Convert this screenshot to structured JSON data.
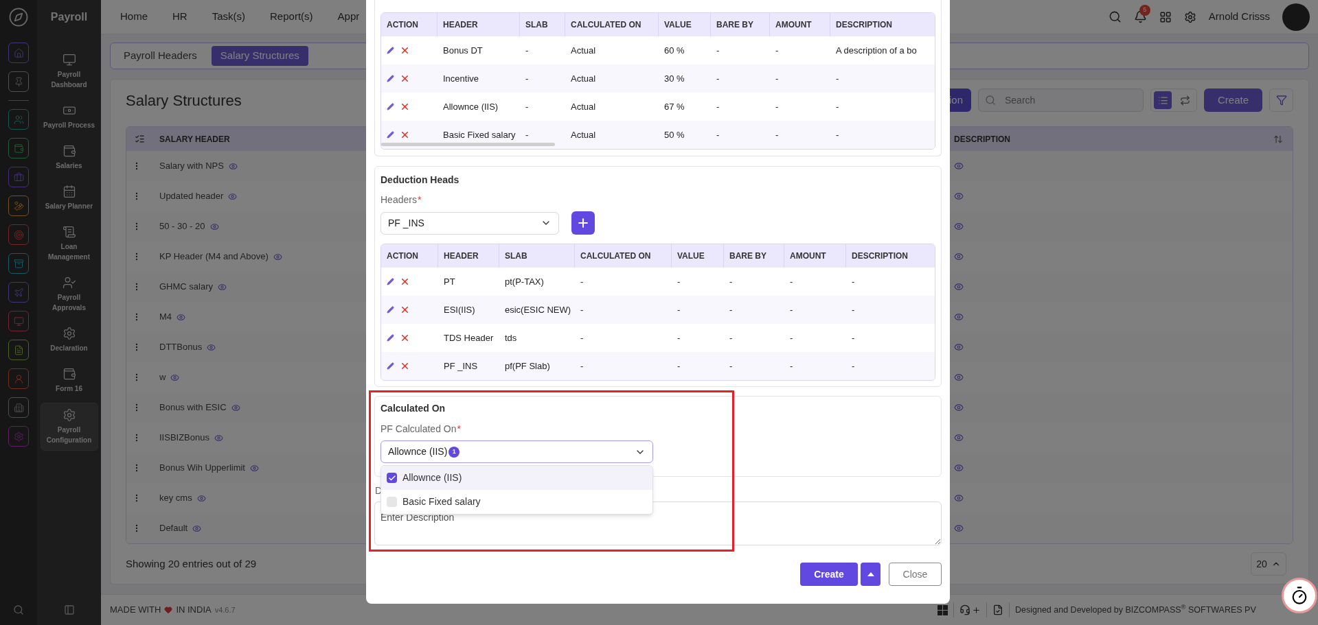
{
  "sidebar": {
    "brand": "Payroll",
    "items": [
      {
        "label": "Payroll Dashboard",
        "selected": false
      },
      {
        "label": "Payroll Process",
        "selected": false
      },
      {
        "label": "Salaries",
        "selected": false
      },
      {
        "label": "Salary Planner",
        "selected": false
      },
      {
        "label": "Loan Management",
        "selected": false
      },
      {
        "label": "Payroll Approvals",
        "selected": false
      },
      {
        "label": "Declaration",
        "selected": false
      },
      {
        "label": "Form 16",
        "selected": false
      },
      {
        "label": "Payroll Configuration",
        "selected": true
      }
    ]
  },
  "nav": {
    "links": [
      "Home",
      "HR",
      "Task(s)",
      "Report(s)",
      "Appr"
    ],
    "notification_count": "5",
    "user_name": "Arnold Crisss"
  },
  "page": {
    "tabs": [
      {
        "label": "Payroll Headers",
        "selected": false
      },
      {
        "label": "Salary Structures",
        "selected": true
      }
    ],
    "title": "Salary Structures",
    "toolbar": {
      "action_button": "ion",
      "search_placeholder": "Search",
      "view_modes": [
        {
          "kind": "list",
          "selected": true
        },
        {
          "kind": "cards",
          "selected": false
        }
      ],
      "create_button": "Create"
    },
    "table": {
      "columns": [
        "SALARY HEADER",
        "DESCRIPTION"
      ],
      "rows": [
        "Salary with NPS",
        "Updated header",
        "50 - 30 - 20",
        "KP Header (M4 and Above)",
        "GHMC salary",
        "M4",
        "DTTBonus",
        "w",
        "Bonus with ESIC",
        "IISBIZBonus",
        "Bonus Wih Upperlimit",
        "key cms",
        "Default"
      ]
    },
    "entries_info": "Showing 20 entries out of 29",
    "page_size": "20"
  },
  "footer": {
    "made_with": "MADE WITH",
    "in_india": "IN INDIA",
    "version": "v4.6.7",
    "credit": "Designed and Developed by BIZCOMPASS$^{®}$ SOFTWARES PV"
  },
  "modal": {
    "earnings_table": {
      "columns": [
        "ACTION",
        "HEADER",
        "SLAB",
        "CALCULATED ON",
        "VALUE",
        "BARE BY",
        "AMOUNT",
        "DESCRIPTION"
      ],
      "rows": [
        [
          "",
          "Bonus DT",
          "-",
          "Actual",
          "60 %",
          "-",
          "-",
          "A description of a bo"
        ],
        [
          "",
          "Incentive",
          "-",
          "Actual",
          "30 %",
          "-",
          "-",
          "-"
        ],
        [
          "",
          "Allownce (IIS)",
          "-",
          "Actual",
          "67 %",
          "-",
          "-",
          "-"
        ],
        [
          "",
          "Basic Fixed salary",
          "-",
          "Actual",
          "50 %",
          "-",
          "-",
          "-"
        ]
      ]
    },
    "deduction": {
      "title": "Deduction Heads",
      "label": "Headers",
      "required_mark": "*",
      "value": "PF _INS",
      "table": {
        "columns": [
          "ACTION",
          "HEADER",
          "SLAB",
          "CALCULATED ON",
          "VALUE",
          "BARE BY",
          "AMOUNT",
          "DESCRIPTION"
        ],
        "rows": [
          [
            "",
            "PT",
            "pt(P-TAX)",
            "-",
            "-",
            "-",
            "-",
            "-"
          ],
          [
            "",
            "ESI(IIS)",
            "esic(ESIC NEW)",
            "-",
            "-",
            "-",
            "-",
            "-"
          ],
          [
            "",
            "TDS Header",
            "tds",
            "-",
            "-",
            "-",
            "-",
            "-"
          ],
          [
            "",
            "PF _INS",
            "pf(PF Slab)",
            "-",
            "-",
            "-",
            "-",
            "-"
          ]
        ]
      }
    },
    "calculated_on": {
      "title": "Calculated On",
      "label": "PF Calculated On",
      "required_mark": "*",
      "value": "Allownce (IIS)",
      "count": "1",
      "expanded": true,
      "options": [
        {
          "label": "Allownce (IIS)",
          "checked": true
        },
        {
          "label": "Basic Fixed salary",
          "checked": false
        }
      ]
    },
    "description": {
      "label": "D",
      "placeholder": "Enter Description"
    },
    "buttons": {
      "create": "Create",
      "close": "Close"
    }
  }
}
